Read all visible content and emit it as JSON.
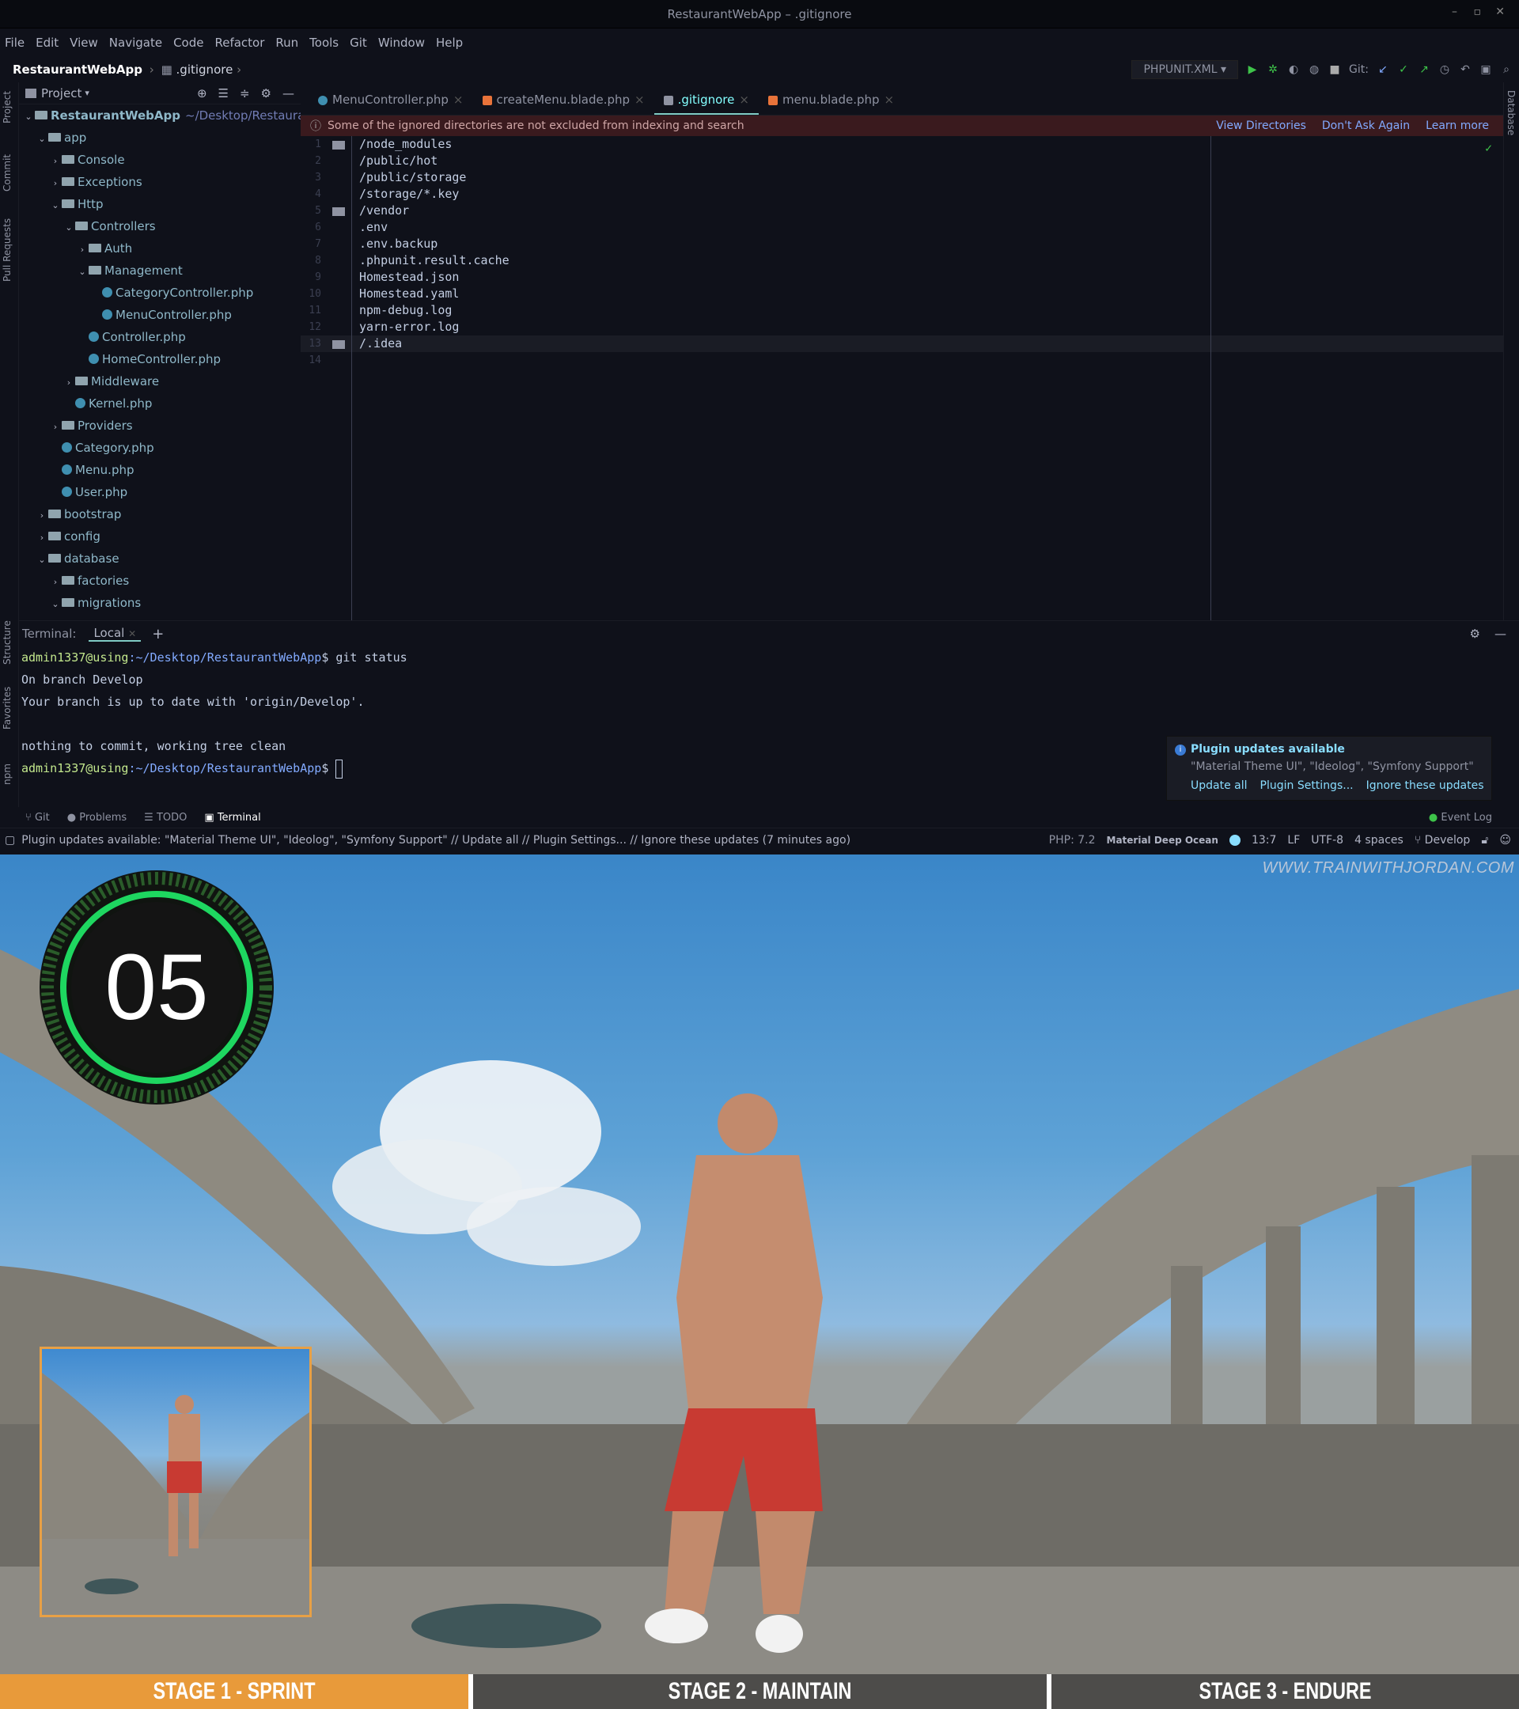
{
  "window": {
    "title": "RestaurantWebApp – .gitignore"
  },
  "menu": [
    "File",
    "Edit",
    "View",
    "Navigate",
    "Code",
    "Refactor",
    "Run",
    "Tools",
    "Git",
    "Window",
    "Help"
  ],
  "breadcrumb": {
    "project": "RestaurantWebApp",
    "file": ".gitignore"
  },
  "toolbar": {
    "run_config": "PHPUNIT.XML",
    "git_label": "Git:"
  },
  "sidebar_labels": [
    "Project",
    "Commit",
    "Pull Requests",
    "Structure",
    "Favorites",
    "npm"
  ],
  "project_panel": {
    "title": "Project",
    "tree": [
      {
        "label": "RestaurantWebApp",
        "extra": "~/Desktop/RestaurantWe",
        "kind": "folder",
        "depth": 0,
        "open": true,
        "bold": true
      },
      {
        "label": "app",
        "kind": "folder",
        "depth": 1,
        "open": true
      },
      {
        "label": "Console",
        "kind": "folder",
        "depth": 2,
        "open": false
      },
      {
        "label": "Exceptions",
        "kind": "folder",
        "depth": 2,
        "open": false
      },
      {
        "label": "Http",
        "kind": "folder",
        "depth": 2,
        "open": true
      },
      {
        "label": "Controllers",
        "kind": "folder",
        "depth": 3,
        "open": true
      },
      {
        "label": "Auth",
        "kind": "folder",
        "depth": 4,
        "open": false
      },
      {
        "label": "Management",
        "kind": "folder",
        "depth": 4,
        "open": true
      },
      {
        "label": "CategoryController.php",
        "kind": "php",
        "depth": 5
      },
      {
        "label": "MenuController.php",
        "kind": "php",
        "depth": 5
      },
      {
        "label": "Controller.php",
        "kind": "php",
        "depth": 4
      },
      {
        "label": "HomeController.php",
        "kind": "php",
        "depth": 4
      },
      {
        "label": "Middleware",
        "kind": "folder",
        "depth": 3,
        "open": false
      },
      {
        "label": "Kernel.php",
        "kind": "php",
        "depth": 3
      },
      {
        "label": "Providers",
        "kind": "folder",
        "depth": 2,
        "open": false
      },
      {
        "label": "Category.php",
        "kind": "php",
        "depth": 2
      },
      {
        "label": "Menu.php",
        "kind": "php",
        "depth": 2
      },
      {
        "label": "User.php",
        "kind": "php",
        "depth": 2
      },
      {
        "label": "bootstrap",
        "kind": "folder",
        "depth": 1,
        "open": false
      },
      {
        "label": "config",
        "kind": "folder",
        "depth": 1,
        "open": false
      },
      {
        "label": "database",
        "kind": "folder",
        "depth": 1,
        "open": true
      },
      {
        "label": "factories",
        "kind": "folder",
        "depth": 2,
        "open": false
      },
      {
        "label": "migrations",
        "kind": "folder",
        "depth": 2,
        "open": true
      }
    ]
  },
  "tabs": [
    {
      "label": "MenuController.php",
      "icon": "php",
      "active": false
    },
    {
      "label": "createMenu.blade.php",
      "icon": "blade",
      "active": false
    },
    {
      "label": ".gitignore",
      "icon": "git",
      "active": true
    },
    {
      "label": "menu.blade.php",
      "icon": "blade",
      "active": false
    }
  ],
  "warning": {
    "text": "Some of the ignored directories are not excluded from indexing and search",
    "actions": [
      "View Directories",
      "Don't Ask Again",
      "Learn more"
    ]
  },
  "editor": {
    "lines": [
      "/node_modules",
      "/public/hot",
      "/public/storage",
      "/storage/*.key",
      "/vendor",
      ".env",
      ".env.backup",
      ".phpunit.result.cache",
      "Homestead.json",
      "Homestead.yaml",
      "npm-debug.log",
      "yarn-error.log",
      "/.idea",
      ""
    ],
    "folder_marks": [
      1,
      5,
      13
    ],
    "current_line": 13
  },
  "terminal": {
    "label": "Terminal:",
    "tab": "Local",
    "prompt_user": "admin1337@using",
    "prompt_path": ":~/Desktop/RestaurantWebApp",
    "command": "git status",
    "output": [
      "On branch Develop",
      "Your branch is up to date with 'origin/Develop'.",
      "",
      "nothing to commit, working tree clean"
    ]
  },
  "notification": {
    "title": "Plugin updates available",
    "body": "\"Material Theme UI\", \"Ideolog\", \"Symfony Support\"",
    "actions": [
      "Update all",
      "Plugin Settings...",
      "Ignore these updates"
    ]
  },
  "tool_windows": [
    "Git",
    "Problems",
    "TODO",
    "Terminal"
  ],
  "event_log": "Event Log",
  "statusbar": {
    "message": "Plugin updates available: \"Material Theme UI\", \"Ideolog\", \"Symfony Support\" // Update all // Plugin Settings... // Ignore these updates (7 minutes ago)",
    "php": "PHP: 7.2",
    "theme": "Material Deep Ocean",
    "position": "13:7",
    "line_sep": "LF",
    "encoding": "UTF-8",
    "indent": "4 spaces",
    "branch": "Develop"
  },
  "video": {
    "watermark": "WWW.TRAINWITHJORDAN.COM",
    "timer": "05",
    "stages": [
      "STAGE 1 - SPRINT",
      "STAGE 2 - MAINTAIN",
      "STAGE 3 - ENDURE"
    ],
    "active_stage": 0
  },
  "colors": {
    "accent": "#80cbc4",
    "link": "#82aaff",
    "timer_ring": "#1ed760",
    "stage_active": "#e89a3a"
  }
}
